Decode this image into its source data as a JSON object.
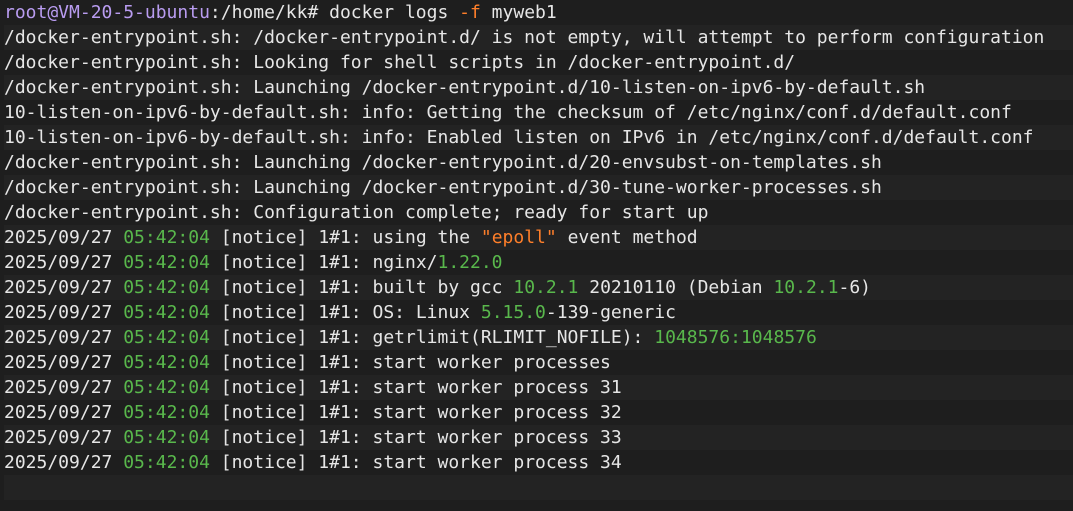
{
  "terminal": {
    "lines": [
      [
        {
          "t": "root@VM-20-5-ubuntu",
          "c": "prompt"
        },
        {
          "t": ":/home/kk# docker logs ",
          "c": "default"
        },
        {
          "t": "-f",
          "c": "flag"
        },
        {
          "t": " myweb1",
          "c": "default"
        }
      ],
      [
        {
          "t": "/docker-entrypoint.sh: /docker-entrypoint.d/ is not empty, will attempt to perform configuration",
          "c": "default"
        }
      ],
      [
        {
          "t": "/docker-entrypoint.sh: Looking for shell scripts in /docker-entrypoint.d/",
          "c": "default"
        }
      ],
      [
        {
          "t": "/docker-entrypoint.sh: Launching /docker-entrypoint.d/10-listen-on-ipv6-by-default.sh",
          "c": "default"
        }
      ],
      [
        {
          "t": "10-listen-on-ipv6-by-default.sh: info: Getting the checksum of /etc/nginx/conf.d/default.conf",
          "c": "default"
        }
      ],
      [
        {
          "t": "10-listen-on-ipv6-by-default.sh: info: Enabled listen on IPv6 in /etc/nginx/conf.d/default.conf",
          "c": "default"
        }
      ],
      [
        {
          "t": "/docker-entrypoint.sh: Launching /docker-entrypoint.d/20-envsubst-on-templates.sh",
          "c": "default"
        }
      ],
      [
        {
          "t": "/docker-entrypoint.sh: Launching /docker-entrypoint.d/30-tune-worker-processes.sh",
          "c": "default"
        }
      ],
      [
        {
          "t": "/docker-entrypoint.sh: Configuration complete; ready for start up",
          "c": "default"
        }
      ],
      [
        {
          "t": "2025/09/27 ",
          "c": "default"
        },
        {
          "t": "05:42:04",
          "c": "green"
        },
        {
          "t": " [",
          "c": "default"
        },
        {
          "t": "notice",
          "c": "default"
        },
        {
          "t": "] 1#1: using the ",
          "c": "default"
        },
        {
          "t": "\"epoll\"",
          "c": "orange"
        },
        {
          "t": " event method",
          "c": "default"
        }
      ],
      [
        {
          "t": "2025/09/27 ",
          "c": "default"
        },
        {
          "t": "05:42:04",
          "c": "green"
        },
        {
          "t": " [notice] 1#1: nginx/",
          "c": "default"
        },
        {
          "t": "1.22.0",
          "c": "green"
        }
      ],
      [
        {
          "t": "2025/09/27 ",
          "c": "default"
        },
        {
          "t": "05:42:04",
          "c": "green"
        },
        {
          "t": " [notice] 1#1: built by gcc ",
          "c": "default"
        },
        {
          "t": "10.2.1",
          "c": "green"
        },
        {
          "t": " 20210110 (Debian ",
          "c": "default"
        },
        {
          "t": "10.2.1",
          "c": "green"
        },
        {
          "t": "-6)",
          "c": "default"
        }
      ],
      [
        {
          "t": "2025/09/27 ",
          "c": "default"
        },
        {
          "t": "05:42:04",
          "c": "green"
        },
        {
          "t": " [notice] 1#1: OS: Linux ",
          "c": "default"
        },
        {
          "t": "5.15.0",
          "c": "green"
        },
        {
          "t": "-139-generic",
          "c": "default"
        }
      ],
      [
        {
          "t": "2025/09/27 ",
          "c": "default"
        },
        {
          "t": "05:42:04",
          "c": "green"
        },
        {
          "t": " [notice] 1#1: getrlimit(RLIMIT_NOFILE): ",
          "c": "default"
        },
        {
          "t": "1048576:1048576",
          "c": "green"
        }
      ],
      [
        {
          "t": "2025/09/27 ",
          "c": "default"
        },
        {
          "t": "05:42:04",
          "c": "green"
        },
        {
          "t": " [notice] 1#1: start worker processes",
          "c": "default"
        }
      ],
      [
        {
          "t": "2025/09/27 ",
          "c": "default"
        },
        {
          "t": "05:42:04",
          "c": "green"
        },
        {
          "t": " [notice] 1#1: start worker process 31",
          "c": "default"
        }
      ],
      [
        {
          "t": "2025/09/27 ",
          "c": "default"
        },
        {
          "t": "05:42:04",
          "c": "green"
        },
        {
          "t": " [notice] 1#1: start worker process 32",
          "c": "default"
        }
      ],
      [
        {
          "t": "2025/09/27 ",
          "c": "default"
        },
        {
          "t": "05:42:04",
          "c": "green"
        },
        {
          "t": " [notice] 1#1: start worker process 33",
          "c": "default"
        }
      ],
      [
        {
          "t": "2025/09/27 ",
          "c": "default"
        },
        {
          "t": "05:42:04",
          "c": "green"
        },
        {
          "t": " [notice] 1#1: start worker process 34",
          "c": "default"
        }
      ]
    ]
  },
  "colors": {
    "background": "#1e1e1e",
    "text": "#e6e6e6",
    "prompt": "#b99cf0",
    "flag": "#ff7f2a",
    "green": "#59b84c",
    "orange": "#ff7f2a",
    "cursor": "#9a9a9a"
  }
}
